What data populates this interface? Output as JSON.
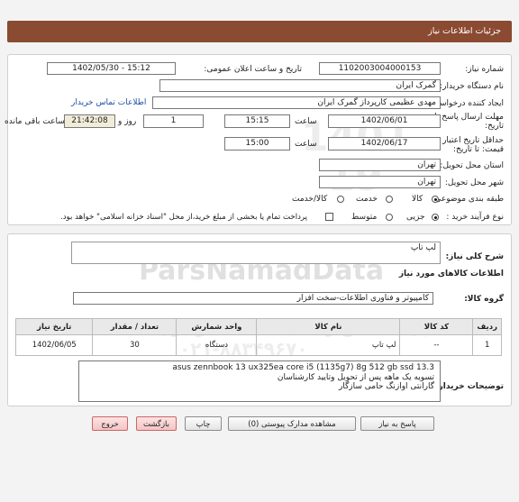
{
  "header": {
    "title": "جزئیات اطلاعات نیاز"
  },
  "info": {
    "need_number_label": "شماره نیاز:",
    "need_number": "1102003004000153",
    "announce_label": "تاریخ و ساعت اعلان عمومی:",
    "announce_value": "1402/05/30 - 15:12",
    "buyer_org_label": "نام دستگاه خریدار:",
    "buyer_org": "گمرک ایران",
    "requester_label": "ایجاد کننده درخواست:",
    "requester": "مهدی عظیمی کارپرداز گمرک ایران",
    "contact_link": "اطلاعات تماس خریدار",
    "deadline_label_1": "مهلت ارسال پاسخ تا",
    "deadline_label_2": "تاریخ:",
    "deadline_date": "1402/06/01",
    "time_label": "ساعت",
    "deadline_time": "15:15",
    "days": "1",
    "day_and_label": "روز و",
    "remaining_time": "21:42:08",
    "remaining_label": "ساعت باقی مانده",
    "validity_label_1": "حداقل تاریخ اعتبار",
    "validity_label_2": "قیمت: تا تاریخ:",
    "validity_date": "1402/06/17",
    "validity_time": "15:00",
    "province_label": "استان محل تحویل:",
    "province": "تهران",
    "city_label": "شهر محل تحویل:",
    "city": "تهران",
    "category_label": "طبقه بندی موضوعی:",
    "category_options": [
      "کالا",
      "خدمت",
      "کالا/خدمت"
    ],
    "process_label": "نوع فرآیند خرید :",
    "process_options": [
      "جزیی",
      "متوسط"
    ],
    "payment_note": "پرداخت تمام یا بخشی از مبلغ خرید،از محل \"اسناد خزانه اسلامی\" خواهد بود."
  },
  "details": {
    "summary_label": "شرح کلی نیاز:",
    "summary": "لپ تاپ",
    "goods_heading": "اطلاعات کالاهای مورد نیاز",
    "group_label": "گروه کالا:",
    "group": "کامپیوتر و فناوری اطلاعات-سخت افزار",
    "columns": [
      "ردیف",
      "کد کالا",
      "نام کالا",
      "واحد شمارش",
      "تعداد / مقدار",
      "تاریخ نیاز"
    ],
    "rows": [
      {
        "index": "1",
        "code": "--",
        "name": "لپ تاپ",
        "unit": "دستگاه",
        "qty": "30",
        "date": "1402/06/05"
      }
    ],
    "buyer_notes_label": "توضیحات خریدار:",
    "buyer_notes": [
      "asus zennbook 13 ux325ea core i5 (1135g7) 8g 512 gb ssd 13.3",
      "تسویه یک ماهه پس از تحویل وتایید کارشناسان",
      "گارانتی اوازنگ حامی سازگار"
    ]
  },
  "buttons": {
    "reply": "پاسخ به نیاز",
    "docs": "مشاهده مدارک پیوستی (0)",
    "print": "چاپ",
    "back": "بازگشت",
    "exit": "خروج"
  },
  "watermark": {
    "brand": "ParsNamadData",
    "slogan": "پایگاه اطلاع رسانی مناقصات و مزایده",
    "phone": "۰۲۱-۸۸۳۴۹۶۷۰",
    "digits": "1401 19"
  }
}
